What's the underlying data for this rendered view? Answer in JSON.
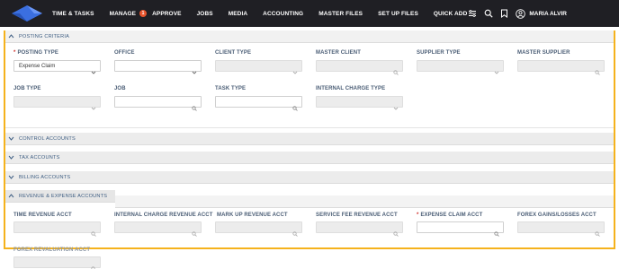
{
  "nav": {
    "items": [
      {
        "label": "TIME & TASKS"
      },
      {
        "label": "MANAGE",
        "badge": "1"
      },
      {
        "label": "APPROVE"
      },
      {
        "label": "JOBS"
      },
      {
        "label": "MEDIA"
      },
      {
        "label": "ACCOUNTING"
      },
      {
        "label": "MASTER FILES"
      },
      {
        "label": "SET UP FILES"
      },
      {
        "label": "QUICK ADD"
      }
    ],
    "user_name": "MARIA ALVIR"
  },
  "sections": {
    "posting_criteria": "POSTING CRITERIA",
    "control_accounts": "CONTROL ACCOUNTS",
    "tax_accounts": "TAX ACCOUNTS",
    "billing_accounts": "BILLING ACCOUNTS",
    "revenue_expense": "REVENUE & EXPENSE ACCOUNTS"
  },
  "posting": {
    "posting_type": {
      "label": "POSTING TYPE",
      "value": "Expense Claim"
    },
    "office": {
      "label": "OFFICE"
    },
    "client_type": {
      "label": "CLIENT TYPE"
    },
    "master_client": {
      "label": "MASTER CLIENT"
    },
    "supplier_type": {
      "label": "SUPPLIER TYPE"
    },
    "master_supplier": {
      "label": "MASTER SUPPLIER"
    },
    "job_type": {
      "label": "JOB TYPE"
    },
    "job": {
      "label": "JOB"
    },
    "task_type": {
      "label": "TASK TYPE"
    },
    "internal_charge_type": {
      "label": "INTERNAL CHARGE TYPE"
    }
  },
  "revenue": {
    "time_revenue": {
      "label": "TIME REVENUE ACCT"
    },
    "internal_charge_revenue": {
      "label": "INTERNAL CHARGE REVENUE ACCT"
    },
    "mark_up_revenue": {
      "label": "MARK UP REVENUE ACCT"
    },
    "service_fee_revenue": {
      "label": "SERVICE FEE REVENUE ACCT"
    },
    "expense_claim": {
      "label": "EXPENSE CLAIM ACCT"
    },
    "forex_gains": {
      "label": "FOREX GAINS/LOSSES ACCT"
    },
    "forex_revaluation": {
      "label": "FOREX REVALUATION ACCT"
    }
  },
  "colors": {
    "topbar": "#1f1f24",
    "highlight_frame": "#f5b21c",
    "section_text": "#3d5d82",
    "required": "#d0312d",
    "badge": "#e8552e",
    "logo": "#3b6fe0"
  },
  "icons": [
    "logo-icon",
    "filter-icon",
    "search-icon",
    "bookmark-icon",
    "user-icon",
    "chevron-down-icon",
    "chevron-up-icon",
    "magnifier-icon"
  ]
}
